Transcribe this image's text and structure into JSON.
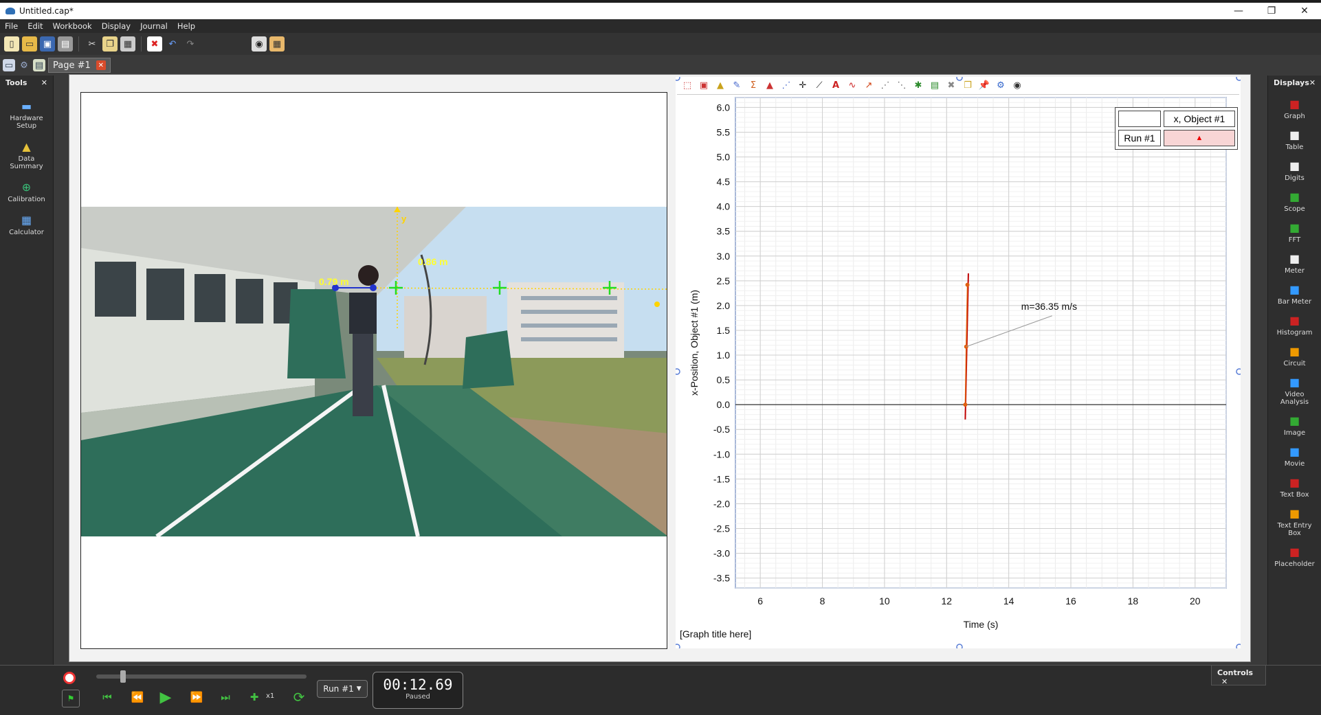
{
  "window": {
    "title": "Untitled.cap*"
  },
  "menu": [
    "File",
    "Edit",
    "Workbook",
    "Display",
    "Journal",
    "Help"
  ],
  "tabs": [
    {
      "label": "Page #1"
    }
  ],
  "tools_panel": {
    "title": "Tools",
    "items": [
      {
        "label": "Hardware Setup",
        "icon": "hardware-icon"
      },
      {
        "label": "Data Summary",
        "icon": "data-summary-icon"
      },
      {
        "label": "Calibration",
        "icon": "calibration-icon"
      },
      {
        "label": "Calculator",
        "icon": "calculator-icon"
      }
    ]
  },
  "displays_panel": {
    "title": "Displays",
    "items": [
      {
        "label": "Graph"
      },
      {
        "label": "Table"
      },
      {
        "label": "Digits"
      },
      {
        "label": "Scope"
      },
      {
        "label": "FFT"
      },
      {
        "label": "Meter"
      },
      {
        "label": "Bar Meter"
      },
      {
        "label": "Histogram"
      },
      {
        "label": "Circuit"
      },
      {
        "label": "Video Analysis"
      },
      {
        "label": "Image"
      },
      {
        "label": "Movie"
      },
      {
        "label": "Text Box"
      },
      {
        "label": "Text Entry Box"
      },
      {
        "label": "Placeholder"
      }
    ]
  },
  "video": {
    "label_left": "0.79 m",
    "label_right": "0.86 m",
    "axis_label": "y"
  },
  "graph": {
    "legend_col1_header": "",
    "legend_col2_header": "x, Object #1",
    "legend_row1": "Run #1",
    "legend_marker": "▲",
    "annotation": "m=36.35 m/s",
    "graph_title_placeholder": "[Graph title here]"
  },
  "chart_data": {
    "type": "line",
    "xlabel": "Time (s)",
    "ylabel": "x-Position, Object #1 (m)",
    "xlim": [
      5.2,
      21.0
    ],
    "ylim": [
      -3.7,
      6.2
    ],
    "x_ticks": [
      6,
      8,
      10,
      12,
      14,
      16,
      18,
      20
    ],
    "y_ticks": [
      6.0,
      5.5,
      5.0,
      4.5,
      4.0,
      3.5,
      3.0,
      2.5,
      2.0,
      1.5,
      1.0,
      0.5,
      0.0,
      -0.5,
      -1.0,
      -1.5,
      -2.0,
      -2.5,
      -3.0,
      -3.5
    ],
    "y_tick_labels": [
      "6.0",
      "5.5",
      "5.0",
      "4.5",
      "4.0",
      "3.5",
      "3.0",
      "2.5",
      "2.0",
      "1.5",
      "1.0",
      "0.5",
      "0.0",
      "-0.5",
      "-1.0",
      "-1.5",
      "-2.0",
      "-2.5",
      "-3.0",
      "-3.5"
    ],
    "series": [
      {
        "name": "Run #1",
        "color": "#e06010",
        "x": [
          12.6,
          12.63,
          12.67
        ],
        "y": [
          0.0,
          1.17,
          2.42
        ]
      }
    ],
    "fit_line": {
      "color": "#c00000",
      "slope": 36.35,
      "x": [
        12.6,
        12.7
      ],
      "y": [
        -0.3,
        2.65
      ]
    },
    "grid": true
  },
  "controls": {
    "title": "Controls",
    "run_select": "Run #1",
    "time": "00:12.69",
    "status": "Paused",
    "speed": "x1"
  }
}
